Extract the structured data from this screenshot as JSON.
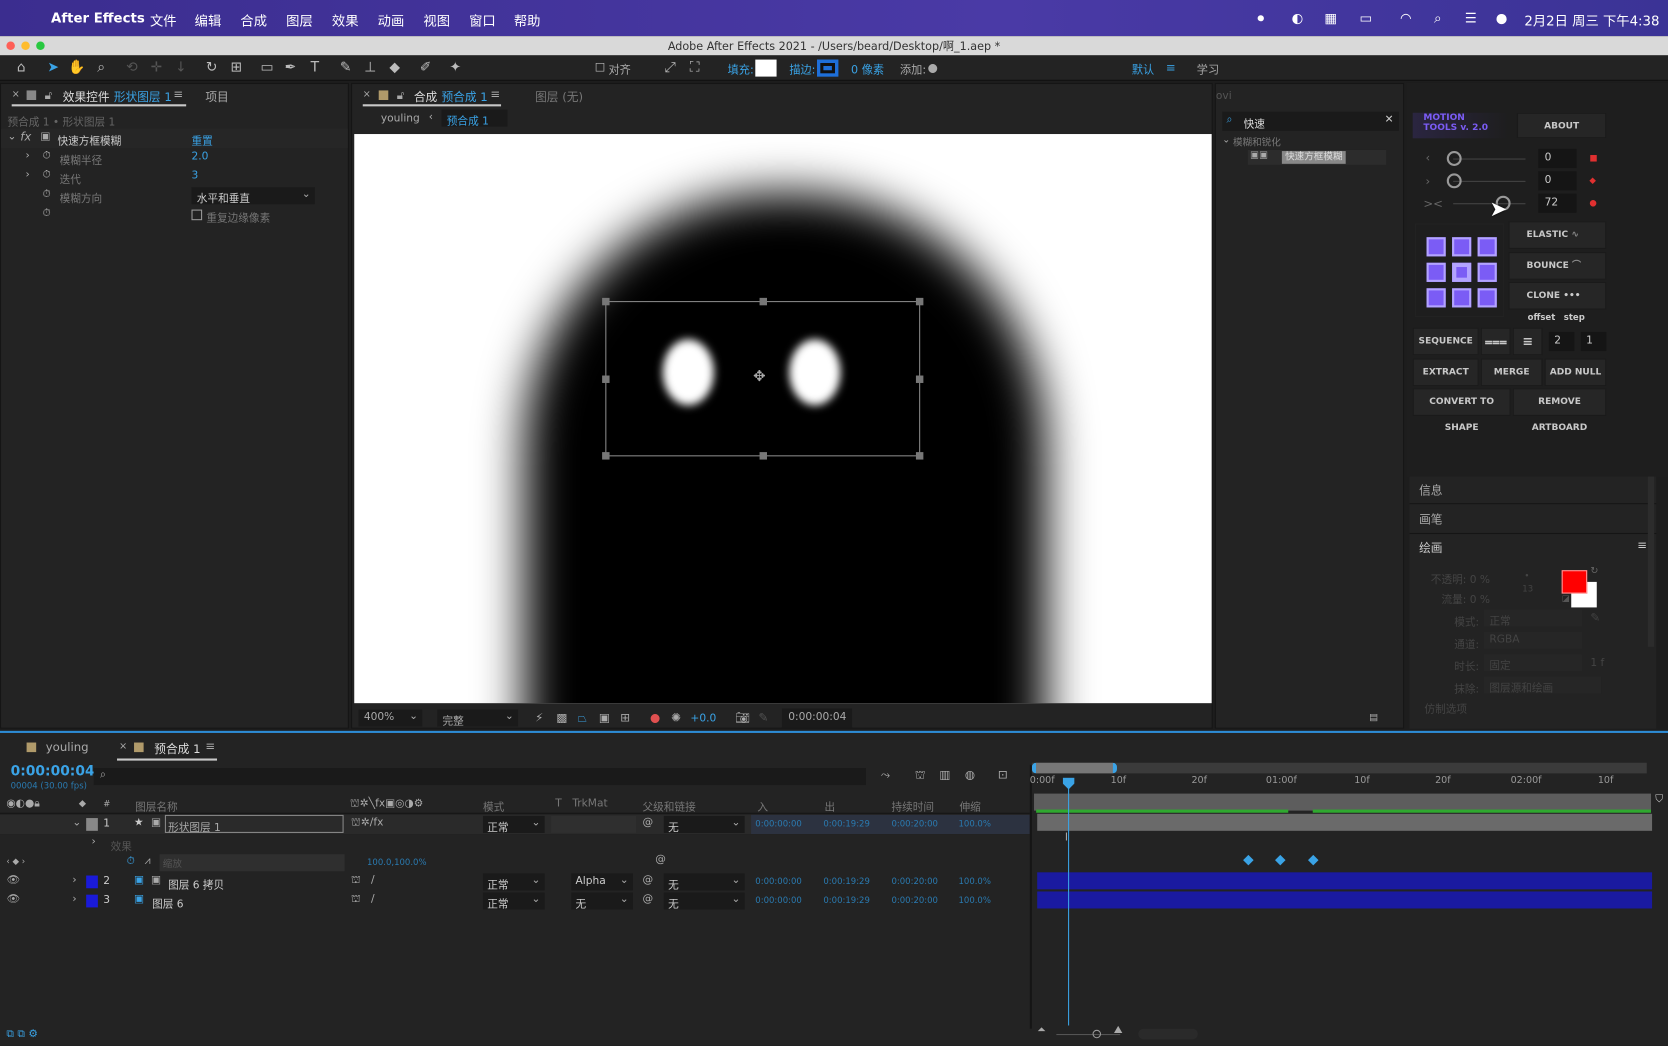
{
  "menubar": {
    "app": "After Effects",
    "items": [
      "文件",
      "编辑",
      "合成",
      "图层",
      "效果",
      "动画",
      "视图",
      "窗口",
      "帮助"
    ],
    "clock": "2月2日 周三 下午4:38"
  },
  "window_title": "Adobe After Effects 2021 - /Users/beard/Desktop/啊_1.aep *",
  "toolbar": {
    "align_label": "对齐",
    "fill_label": "填充:",
    "stroke_label": "描边:",
    "stroke_px": "0 像素",
    "add_label": "添加:",
    "workspace": "默认",
    "learn": "学习",
    "fill_color": "#ffffff",
    "stroke_color": "#1e6fd9"
  },
  "effect_controls": {
    "tab_prefix": "效果控件",
    "tab_layer": "形状图层 1",
    "tab_project": "项目",
    "breadcrumb": "预合成 1 • 形状图层 1",
    "effect_name": "快速方框模糊",
    "reset": "重置",
    "props": [
      {
        "name": "模糊半径",
        "value": "2.0"
      },
      {
        "name": "迭代",
        "value": "3"
      },
      {
        "name": "模糊方向",
        "value": "水平和垂直"
      },
      {
        "name": "",
        "value": "重复边缘像素"
      }
    ]
  },
  "composition": {
    "tab_prefix": "合成",
    "tab_name": "预合成 1",
    "layer_tab": "图层 (无)",
    "crumb_parent": "youling",
    "crumb_current": "预合成 1",
    "zoom": "400%",
    "quality": "完整",
    "exposure": "+0.0",
    "timecode": "0:00:00:04"
  },
  "effects_presets": {
    "search_value": "快速",
    "category": "模糊和锐化",
    "item": "快速方框模糊"
  },
  "motion_tools": {
    "logo_line1": "MOTION",
    "logo_line2": "TOOLS v. 2.0",
    "about": "ABOUT",
    "slider_values": [
      "0",
      "0",
      "72"
    ],
    "slider_level_third": 72,
    "elastic": "ELASTIC",
    "bounce": "BOUNCE",
    "clone": "CLONE",
    "offset": "offset",
    "step": "step",
    "sequence": "SEQUENCE",
    "offset_value": "2",
    "step_value": "1",
    "extract": "EXTRACT",
    "merge": "MERGE",
    "add_null": "ADD NULL",
    "convert": "CONVERT TO SHAPE",
    "remove_artboard": "REMOVE ARTBOARD",
    "accent": "#7b5cf5"
  },
  "side_panels": {
    "info": "信息",
    "brush": "画笔",
    "paint": "绘画",
    "opacity": "不透明: 0 %",
    "flow": "流量: 0 %",
    "brush_size": "13",
    "mode_label": "模式:",
    "mode_value": "正常",
    "channel_label": "通道:",
    "channel_value": "RGBA",
    "duration_label": "时长:",
    "duration_value": "固定",
    "duration_frames": "1 f",
    "erase_label": "抹除:",
    "erase_value": "图层源和绘画",
    "clone_options": "仿制选项",
    "fg_color": "#ff0000",
    "bg_color": "#ffffff"
  },
  "timeline": {
    "tabs": [
      "youling",
      "预合成 1"
    ],
    "timecode": "0:00:00:04",
    "frame_info": "00004 (30.00 fps)",
    "columns": [
      "图层名称",
      "模式",
      "T",
      "TrkMat",
      "父级和链接",
      "入",
      "出",
      "持续时间",
      "伸缩"
    ],
    "ruler": [
      "0:00f",
      "10f",
      "20f",
      "01:00f",
      "10f",
      "20f",
      "02:00f",
      "10f"
    ],
    "layers": [
      {
        "num": "1",
        "name": "形状图层 1",
        "mode": "正常",
        "trkmat": "",
        "parent": "无",
        "in": "0:00:00:00",
        "out": "0:00:19:29",
        "dur": "0:00:20:00",
        "stretch": "100.0%",
        "color": "#888888"
      },
      {
        "num": "2",
        "name": "图层 6 拷贝",
        "mode": "正常",
        "trkmat": "Alpha",
        "parent": "无",
        "in": "0:00:00:00",
        "out": "0:00:19:29",
        "dur": "0:00:20:00",
        "stretch": "100.0%",
        "color": "#1a1ad8"
      },
      {
        "num": "3",
        "name": "图层 6",
        "mode": "正常",
        "trkmat": "无",
        "parent": "无",
        "in": "0:00:00:00",
        "out": "0:00:19:29",
        "dur": "0:00:20:00",
        "stretch": "100.0%",
        "color": "#1a1ad8"
      }
    ],
    "effects_group": "效果",
    "scale_prop": "缩放",
    "scale_value": "100.0,100.0%"
  }
}
